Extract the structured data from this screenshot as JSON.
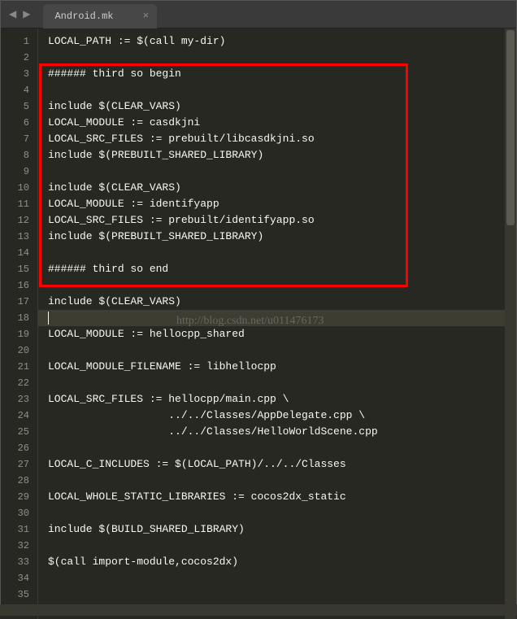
{
  "tab": {
    "filename": "Android.mk",
    "close": "×"
  },
  "nav": {
    "prev": "◀",
    "next": "▶"
  },
  "watermark": "http://blog.csdn.net/u011476173",
  "highlight": {
    "startLine": 3,
    "endLine": 15
  },
  "activeLine": 18,
  "lines": [
    {
      "n": 1,
      "t": "LOCAL_PATH := $(call my-dir)"
    },
    {
      "n": 2,
      "t": ""
    },
    {
      "n": 3,
      "t": "###### third so begin"
    },
    {
      "n": 4,
      "t": ""
    },
    {
      "n": 5,
      "t": "include $(CLEAR_VARS)"
    },
    {
      "n": 6,
      "t": "LOCAL_MODULE := casdkjni"
    },
    {
      "n": 7,
      "t": "LOCAL_SRC_FILES := prebuilt/libcasdkjni.so"
    },
    {
      "n": 8,
      "t": "include $(PREBUILT_SHARED_LIBRARY)"
    },
    {
      "n": 9,
      "t": ""
    },
    {
      "n": 10,
      "t": "include $(CLEAR_VARS)"
    },
    {
      "n": 11,
      "t": "LOCAL_MODULE := identifyapp"
    },
    {
      "n": 12,
      "t": "LOCAL_SRC_FILES := prebuilt/identifyapp.so"
    },
    {
      "n": 13,
      "t": "include $(PREBUILT_SHARED_LIBRARY)"
    },
    {
      "n": 14,
      "t": ""
    },
    {
      "n": 15,
      "t": "###### third so end"
    },
    {
      "n": 16,
      "t": ""
    },
    {
      "n": 17,
      "t": "include $(CLEAR_VARS)"
    },
    {
      "n": 18,
      "t": ""
    },
    {
      "n": 19,
      "t": "LOCAL_MODULE := hellocpp_shared"
    },
    {
      "n": 20,
      "t": ""
    },
    {
      "n": 21,
      "t": "LOCAL_MODULE_FILENAME := libhellocpp"
    },
    {
      "n": 22,
      "t": ""
    },
    {
      "n": 23,
      "t": "LOCAL_SRC_FILES := hellocpp/main.cpp \\"
    },
    {
      "n": 24,
      "t": "                   ../../Classes/AppDelegate.cpp \\"
    },
    {
      "n": 25,
      "t": "                   ../../Classes/HelloWorldScene.cpp"
    },
    {
      "n": 26,
      "t": ""
    },
    {
      "n": 27,
      "t": "LOCAL_C_INCLUDES := $(LOCAL_PATH)/../../Classes"
    },
    {
      "n": 28,
      "t": ""
    },
    {
      "n": 29,
      "t": "LOCAL_WHOLE_STATIC_LIBRARIES := cocos2dx_static"
    },
    {
      "n": 30,
      "t": ""
    },
    {
      "n": 31,
      "t": "include $(BUILD_SHARED_LIBRARY)"
    },
    {
      "n": 32,
      "t": ""
    },
    {
      "n": 33,
      "t": "$(call import-module,cocos2dx)"
    },
    {
      "n": 34,
      "t": ""
    },
    {
      "n": 35,
      "t": ""
    }
  ]
}
